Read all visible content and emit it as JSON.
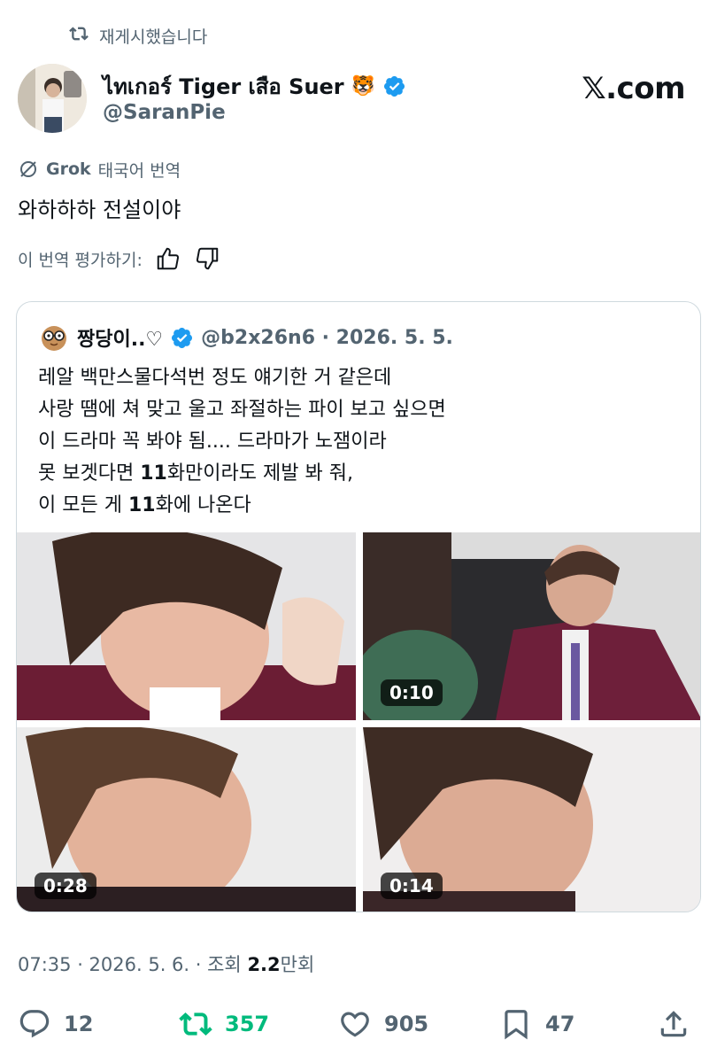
{
  "repost": {
    "label": "재게시했습니다"
  },
  "author": {
    "name": "ไทเกอร์ Tiger เสือ Suer",
    "emoji": "🐯",
    "handle": "@SaranPie"
  },
  "brand": "𝕏.com",
  "translation": {
    "provider": "Grok",
    "label": "태국어 번역",
    "text": "와하하하 전설이야",
    "rate_label": "이 번역 평가하기:"
  },
  "quote": {
    "name": "짱당이..♡",
    "handle_date": "@b2x26n6 · 2026. 5. 5.",
    "text": "레알 백만스물다석번 정도 얘기한 거 같은데\n사랑 땜에 쳐 맞고 울고 좌절하는 파이 보고 싶으면\n이 드라마 꼭 봐야 됨.... 드라마가 노잼이라\n못 보겟다면 11화만이라도 제발 봐 줘,\n이 모든 게 11화에 나온다",
    "videos": [
      {
        "duration": ""
      },
      {
        "duration": "0:10"
      },
      {
        "duration": "0:28"
      },
      {
        "duration": "0:14"
      }
    ]
  },
  "meta": {
    "time_date": "07:35 · 2026. 5. 6. · 조회 ",
    "views_number": "2.2",
    "views_unit": "만회"
  },
  "actions": {
    "replies": "12",
    "reposts": "357",
    "likes": "905",
    "bookmarks": "47"
  },
  "colors": {
    "accent": "#1d9bf0",
    "repost_green": "#00ba7c",
    "secondary": "#536471"
  }
}
